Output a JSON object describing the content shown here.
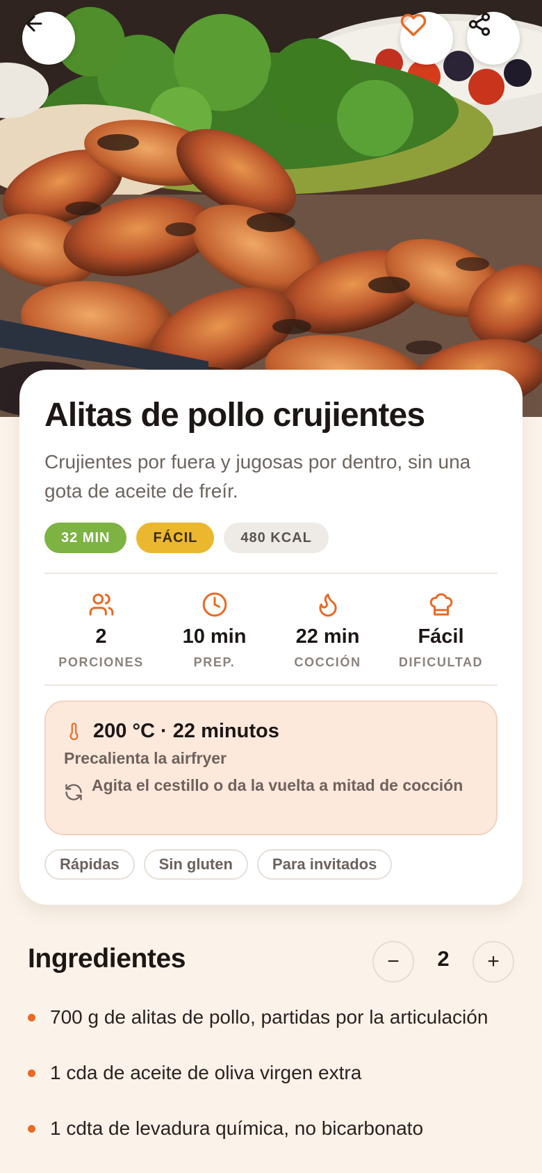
{
  "hero": {
    "image": "grilled-chicken-wings-photo",
    "back_icon": "arrow-left-icon",
    "favorite_icon": "heart-icon",
    "share_icon": "share-icon"
  },
  "recipe": {
    "title": "Alitas de pollo crujientes",
    "description": "Crujientes por fuera y jugosas por dentro, sin una gota de aceite de freír.",
    "badges": [
      {
        "label": "32 MIN",
        "color": "#7cb342"
      },
      {
        "label": "FÁCIL",
        "color": "#ebb72f"
      },
      {
        "label": "480 KCAL",
        "color": "#eeebe6"
      }
    ],
    "stats": [
      {
        "icon": "users-icon",
        "value": "2",
        "label": "PORCIONES"
      },
      {
        "icon": "clock-icon",
        "value": "10 min",
        "label": "PREP."
      },
      {
        "icon": "flame-icon",
        "value": "22 min",
        "label": "COCCIÓN"
      },
      {
        "icon": "chef-hat-icon",
        "value": "Fácil",
        "label": "DIFICULTAD"
      }
    ],
    "airfryer": {
      "icon": "thermometer-icon",
      "setting": "200 °C · 22 minutos",
      "preheat": "Precalienta la airfryer",
      "shake_icon": "rotate-icon",
      "shake": "Agita el cestillo o da la vuelta a mitad de cocción"
    },
    "tags": [
      "Rápidas",
      "Sin gluten",
      "Para invitados"
    ]
  },
  "ingredients": {
    "title": "Ingredientes",
    "servings": "2",
    "minus_label": "−",
    "plus_label": "+",
    "items": [
      "700 g de alitas de pollo, partidas por la articulación",
      "1 cda de aceite de oliva virgen extra",
      "1 cdta de levadura química, no bicarbonato"
    ]
  },
  "colors": {
    "accent": "#e86a24",
    "background": "#fbf3ea",
    "tip_background": "#fde8dc"
  }
}
